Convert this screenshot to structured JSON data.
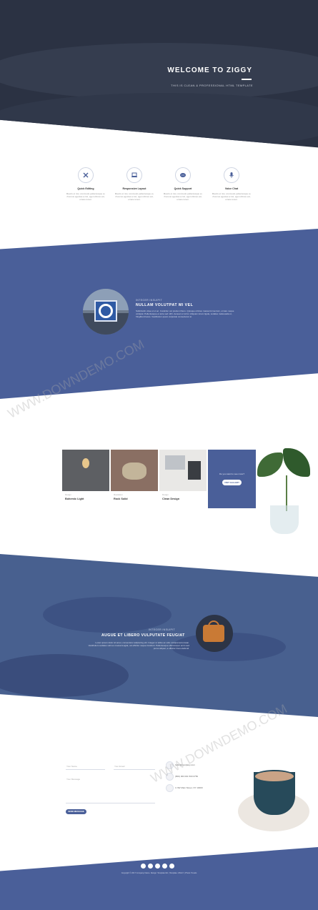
{
  "hero": {
    "title": "WELCOME TO ZIGGY",
    "subtitle": "THIS IS CLEAN & PROFESSIONAL HTML TEMPLATE"
  },
  "features": [
    {
      "title": "Quick Editing",
      "icon": "tools-icon",
      "text": "Mauris et nisi, commodo pellentesque et, rhoncus egestas a nisi, eget ultrices est, ornare lorem."
    },
    {
      "title": "Responsive Layout",
      "icon": "laptop-icon",
      "text": "Mauris et nisi, commodo pellentesque et, rhoncus egestas a nisi, eget ultrices est, ornare lorem."
    },
    {
      "title": "Quick Support",
      "icon": "chat-icon",
      "text": "Mauris et nisi, commodo pellentesque et, rhoncus egestas a nisi, eget ultrices est, ornare lorem."
    },
    {
      "title": "Voice Chat",
      "icon": "microphone-icon",
      "text": "Mauris et nisi, commodo pellentesque et, rhoncus egestas a nisi, eget ultrices est, ornare lorem."
    }
  ],
  "about": {
    "eyebrow": "INTEGER INSUIPIT",
    "title": "NULLAM VOLUTPAT MI VEL",
    "text": "Sollicitudin vitae ut ut ac. Curabitur vel pretium libero. Quisque ultrices massa fermentum, ornare neque volutpat. Pellentesque et ante sed nibh. Aenean ut tortor. Aliquam lorem ligula, sodales malesuada ut, fringilla id lacus. Vestibulum quam vulputate consectetur at."
  },
  "portfolio": {
    "items": [
      {
        "category": "Design",
        "name": "Bohemic Light"
      },
      {
        "category": "Illustration",
        "name": "Rock Solid"
      },
      {
        "category": "Design",
        "name": "Clean Design"
      }
    ],
    "cta_text": "Do you want to see more?",
    "cta_button": "VISIT GALLERY"
  },
  "testimonial": {
    "eyebrow": "INTEGER INSUIPIT",
    "title": "AUGUE ET LIBERO VULPUTATE FEUGIAT",
    "text": "Lorem ipsum dolor sit amet, consectetur adipiscing elit. Integer ut tellus ac odio volutpat accumsan. Vestibulum sodales velit eu massa feugiat, vel efficitur neque tincidunt. Pellentesque ullamcorper enim sed purus aliquet, a efficitur risus eleifend."
  },
  "contact": {
    "name_placeholder": "Your Name",
    "email_placeholder": "Your Email",
    "message_placeholder": "Your Message",
    "send_button": "SEND MESSAGE",
    "email": "hello@company.com",
    "phone": "(800) 003 001 500 0750",
    "address": "1 NW Main Street, NY 10000"
  },
  "footer": {
    "social": [
      "facebook-icon",
      "twitter-icon",
      "linkedin-icon",
      "dribbble-icon",
      "instagram-icon"
    ],
    "copyright": "Copyright © 2017 Company Name. Design: Template Mo | Template: ZIGGY | Photo: Pexels"
  },
  "watermark": "WWW.DOWNDEMO.COM",
  "colors": {
    "accent": "#4a5f99",
    "hero_bg": "#2b3243"
  }
}
